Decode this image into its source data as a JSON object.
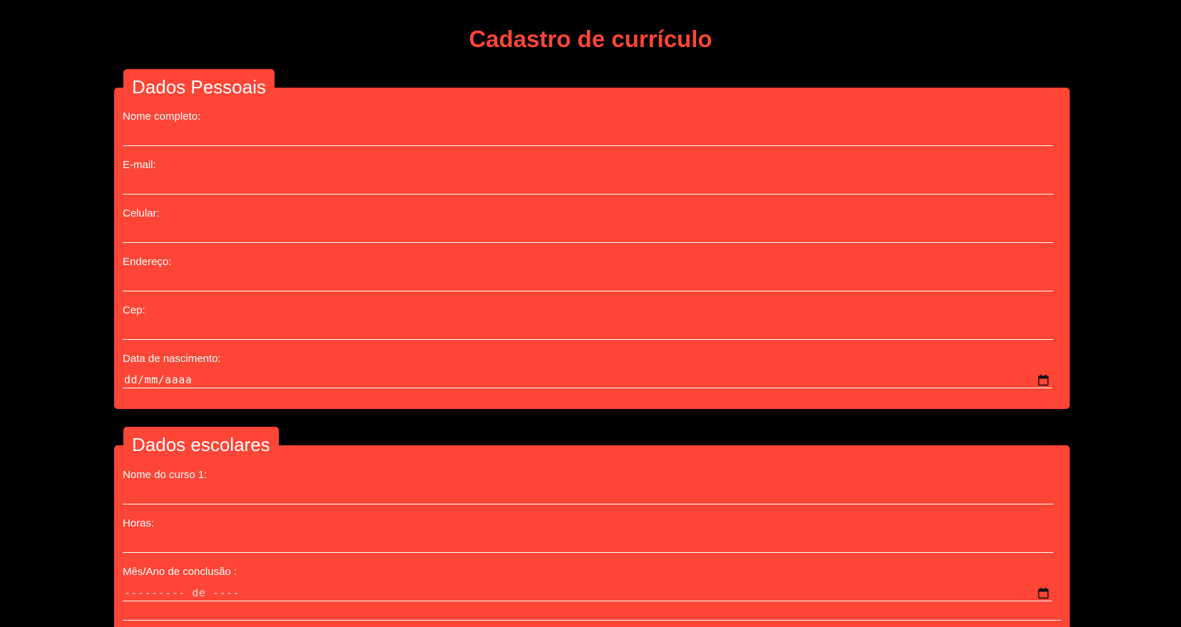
{
  "page": {
    "title": "Cadastro de currículo"
  },
  "personal": {
    "legend": "Dados Pessoais",
    "fields": [
      {
        "label": "Nome completo:",
        "value": ""
      },
      {
        "label": "E-mail:",
        "value": ""
      },
      {
        "label": "Celular:",
        "value": ""
      },
      {
        "label": "Endereço:",
        "value": ""
      },
      {
        "label": "Cep:",
        "value": ""
      },
      {
        "label": "Data de nascimento:",
        "placeholder": "dd/mm/aaaa"
      }
    ]
  },
  "school": {
    "legend": "Dados escolares",
    "fields": [
      {
        "label": "Nome do curso 1:",
        "value": ""
      },
      {
        "label": "Horas:",
        "value": ""
      },
      {
        "label": "Mês/Ano de conclusão :",
        "placeholder": "--------- de ----"
      }
    ]
  },
  "colors": {
    "background": "#000000",
    "accent": "#ff4535",
    "text": "#ffffff"
  },
  "icons": {
    "date_picker": "calendar-icon"
  }
}
